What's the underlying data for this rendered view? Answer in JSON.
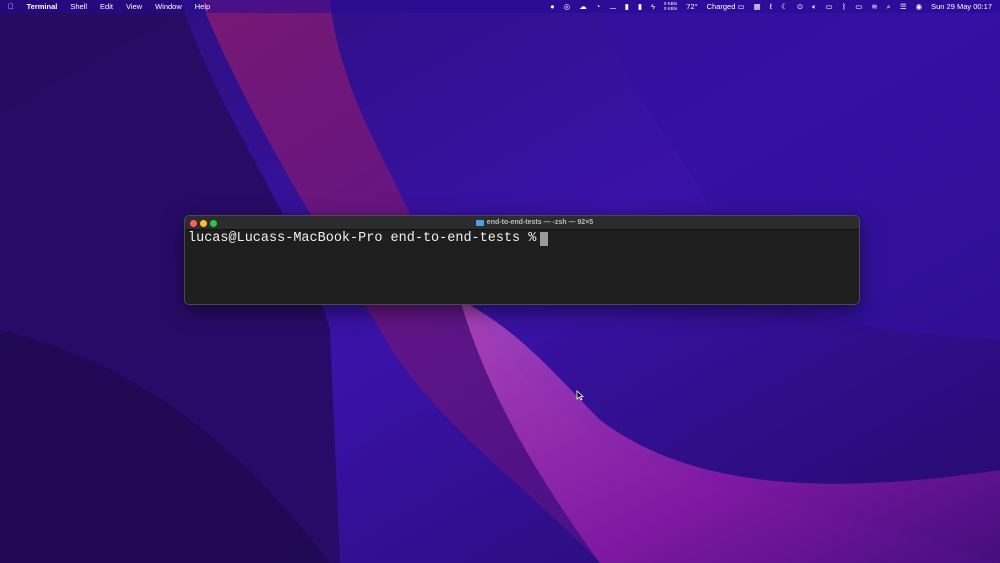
{
  "menubar": {
    "app": "Terminal",
    "menus": [
      "Shell",
      "Edit",
      "View",
      "Window",
      "Help"
    ],
    "network": {
      "up": "0 KB/s",
      "down": "0 KB/s"
    },
    "temperature": "72°",
    "battery_status": "Charged",
    "datetime": "Sun 29 May  00:17"
  },
  "terminal": {
    "title": "end-to-end-tests — -zsh — 92×5",
    "prompt": "lucas@Lucass-MacBook-Pro end-to-end-tests %"
  },
  "colors": {
    "close": "#ff5f57",
    "minimize": "#febc2e",
    "zoom": "#28c840",
    "accent": "#4aa3e0"
  }
}
